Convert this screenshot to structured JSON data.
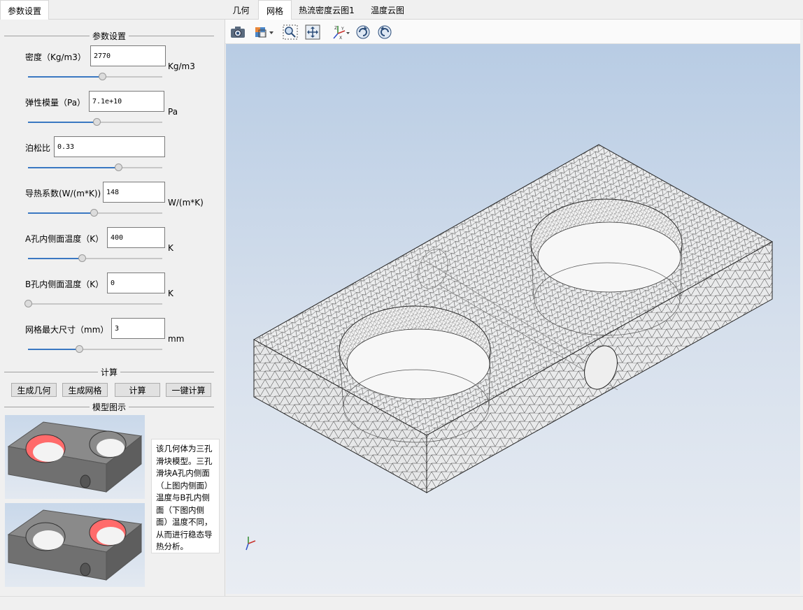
{
  "left_tab": {
    "label": "参数设置"
  },
  "params_section": {
    "title": "参数设置"
  },
  "params": [
    {
      "label": "密度（Kg/m3）",
      "value": "2770",
      "unit": "Kg/m3",
      "slider": 0.55
    },
    {
      "label": "弹性模量（Pa）",
      "value": "7.1e+10",
      "unit": "Pa",
      "slider": 0.51
    },
    {
      "label": "泊松比",
      "value": "0.33",
      "unit": "",
      "slider": 0.67
    },
    {
      "label": "导热系数(W/(m*K))",
      "value": "148",
      "unit": "W/(m*K)",
      "slider": 0.49
    },
    {
      "label": "A孔内侧面温度（K）",
      "value": "400",
      "unit": "K",
      "slider": 0.4
    },
    {
      "label": "B孔内侧面温度（K）",
      "value": "0",
      "unit": "K",
      "slider": 0.0
    },
    {
      "label": "网格最大尺寸（mm）",
      "value": "3",
      "unit": "mm",
      "slider": 0.38
    }
  ],
  "calc_section": {
    "title": "计算"
  },
  "buttons": {
    "gen_geometry": "生成几何",
    "gen_mesh": "生成网格",
    "compute": "计算",
    "one_click": "一键计算"
  },
  "model_section": {
    "title": "模型图示"
  },
  "model_description": "该几何体为三孔滑块模型。三孔滑块A孔内侧面（上图内侧面）温度与B孔内侧面（下图内侧面）温度不同，从而进行稳态导热分析。",
  "right_tabs": [
    "几何",
    "网格",
    "热流密度云图1",
    "温度云图"
  ],
  "active_right_tab": "网格",
  "toolbar_icons": [
    "camera-icon",
    "view-cube-icon",
    "zoom-box-icon",
    "fit-all-icon",
    "axes-icon",
    "rotate-cw-icon",
    "rotate-ccw-icon"
  ],
  "colors": {
    "accent": "#3a78c2",
    "hole_highlight": "#ff6b6b",
    "viewport_top": "#b8cce4",
    "viewport_bottom": "#e9edf3"
  }
}
